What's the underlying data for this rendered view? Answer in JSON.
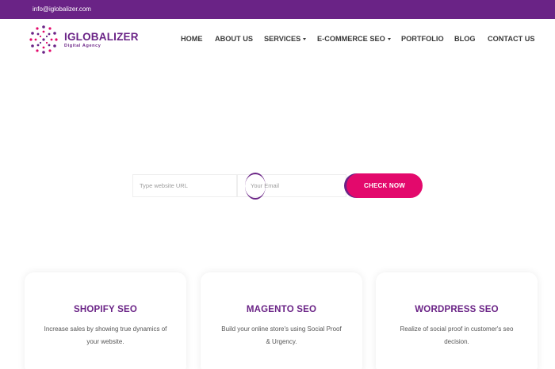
{
  "topbar": {
    "email": "info@iglobalizer.com"
  },
  "brand": {
    "name": "IGLOBALIZER",
    "tagline": "Digital Agency",
    "color": "#6a2386",
    "accent": "#e3096c"
  },
  "nav": {
    "items": [
      {
        "label": "HOME",
        "dropdown": false
      },
      {
        "label": "ABOUT US",
        "dropdown": false
      },
      {
        "label": "SERVICES",
        "dropdown": true
      },
      {
        "label": "E-COMMERCE SEO",
        "dropdown": true
      },
      {
        "label": "PORTFOLIO",
        "dropdown": false
      },
      {
        "label": "BLOG",
        "dropdown": false
      },
      {
        "label": "CONTACT US",
        "dropdown": false
      }
    ]
  },
  "form": {
    "url_placeholder": "Type website URL",
    "email_placeholder": "Your Email",
    "submit_label": "CHECK NOW"
  },
  "cards": [
    {
      "title": "SHOPIFY SEO",
      "description": "Increase sales by showing true dynamics of your website."
    },
    {
      "title": "MAGENTO SEO",
      "description": "Build your online store's using Social Proof & Urgency."
    },
    {
      "title": "WORDPRESS SEO",
      "description": "Realize of social proof in customer's seo decision."
    }
  ]
}
